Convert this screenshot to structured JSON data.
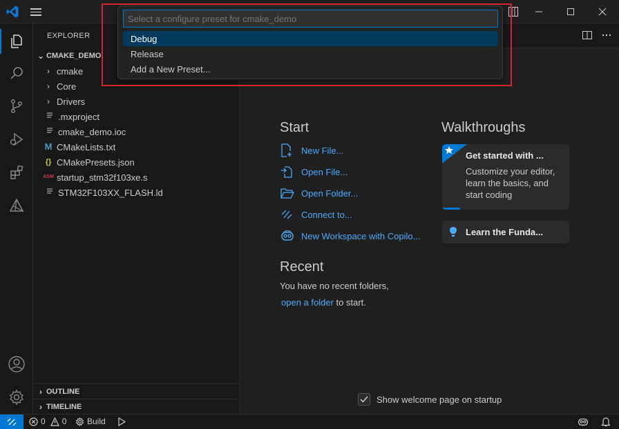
{
  "explorer": {
    "title": "EXPLORER",
    "root": "CMAKE_DEMO",
    "items": [
      {
        "label": "cmake",
        "type": "folder",
        "icon": "chevron-right-icon"
      },
      {
        "label": "Core",
        "type": "folder",
        "icon": "chevron-right-icon"
      },
      {
        "label": "Drivers",
        "type": "folder",
        "icon": "chevron-right-icon"
      },
      {
        "label": ".mxproject",
        "type": "file",
        "icon": "lines-file-icon"
      },
      {
        "label": "cmake_demo.ioc",
        "type": "file",
        "icon": "lines-file-icon"
      },
      {
        "label": "CMakeLists.txt",
        "type": "file",
        "icon": "cmake-m-icon",
        "icon_text": "M"
      },
      {
        "label": "CMakePresets.json",
        "type": "file",
        "icon": "json-braces-icon",
        "icon_text": "{}"
      },
      {
        "label": "startup_stm32f103xe.s",
        "type": "file",
        "icon": "asm-icon",
        "icon_text": "ASM"
      },
      {
        "label": "STM32F103XX_FLASH.ld",
        "type": "file",
        "icon": "lines-file-icon"
      }
    ],
    "outline": "OUTLINE",
    "timeline": "TIMELINE"
  },
  "quickpick": {
    "placeholder": "Select a configure preset for cmake_demo",
    "items": [
      "Debug",
      "Release",
      "Add a New Preset..."
    ],
    "selected_index": 0
  },
  "welcome": {
    "start_heading": "Start",
    "start_items": [
      {
        "label": "New File...",
        "icon": "new-file-icon"
      },
      {
        "label": "Open File...",
        "icon": "open-file-icon"
      },
      {
        "label": "Open Folder...",
        "icon": "open-folder-icon"
      },
      {
        "label": "Connect to...",
        "icon": "remote-connect-icon"
      },
      {
        "label": "New Workspace with Copilo...",
        "icon": "copilot-icon"
      }
    ],
    "recent_heading": "Recent",
    "recent_text": "You have no recent folders,",
    "recent_link": "open a folder",
    "recent_suffix": "to start.",
    "walkthroughs_heading": "Walkthroughs",
    "walk1_title": "Get started with ...",
    "walk1_desc": "Customize your editor, learn the basics, and start coding",
    "walk2_title": "Learn the Funda...",
    "show_on_startup": "Show welcome page on startup",
    "show_on_startup_checked": true
  },
  "statusbar": {
    "errors": "0",
    "warnings": "0",
    "build": "Build"
  },
  "colors": {
    "accent": "#0078d4",
    "link": "#4daafc",
    "highlight_border": "#d9262c"
  }
}
